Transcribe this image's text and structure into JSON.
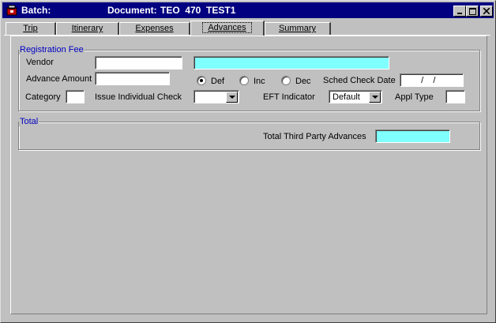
{
  "window": {
    "app_label": "Batch:",
    "document_label": "Document:",
    "document_id": "TEO  470  TEST1",
    "icon": "app-icon",
    "buttons": [
      "minimize-icon",
      "maximize-icon",
      "close-icon"
    ]
  },
  "tabs": [
    {
      "label": "Trip",
      "active": false
    },
    {
      "label": "Itinerary",
      "active": false
    },
    {
      "label": "Expenses",
      "active": false
    },
    {
      "label": "Advances",
      "active": true
    },
    {
      "label": "Summary",
      "active": false
    }
  ],
  "registration": {
    "title": "Registration Fee",
    "vendor_label": "Vendor",
    "vendor_code": "",
    "vendor_name": "",
    "advance_amount_label": "Advance Amount",
    "advance_amount": "",
    "radio_def": "Def",
    "radio_inc": "Inc",
    "radio_dec": "Dec",
    "selected_radio": "Def",
    "sched_check_date_label": "Sched Check Date",
    "sched_check_date": "  /    /",
    "category_label": "Category",
    "category": "",
    "issue_check_label": "Issue Individual Check",
    "issue_check": "",
    "eft_label": "EFT Indicator",
    "eft_value": "Default",
    "appl_type_label": "Appl Type",
    "appl_type": ""
  },
  "total": {
    "title": "Total",
    "third_party_label": "Total Third Party Advances",
    "third_party_value": ""
  },
  "colors": {
    "titlebar": "#000080",
    "group_title": "#0000c0",
    "highlight_field": "#80ffff",
    "background": "#c0c0c0"
  }
}
